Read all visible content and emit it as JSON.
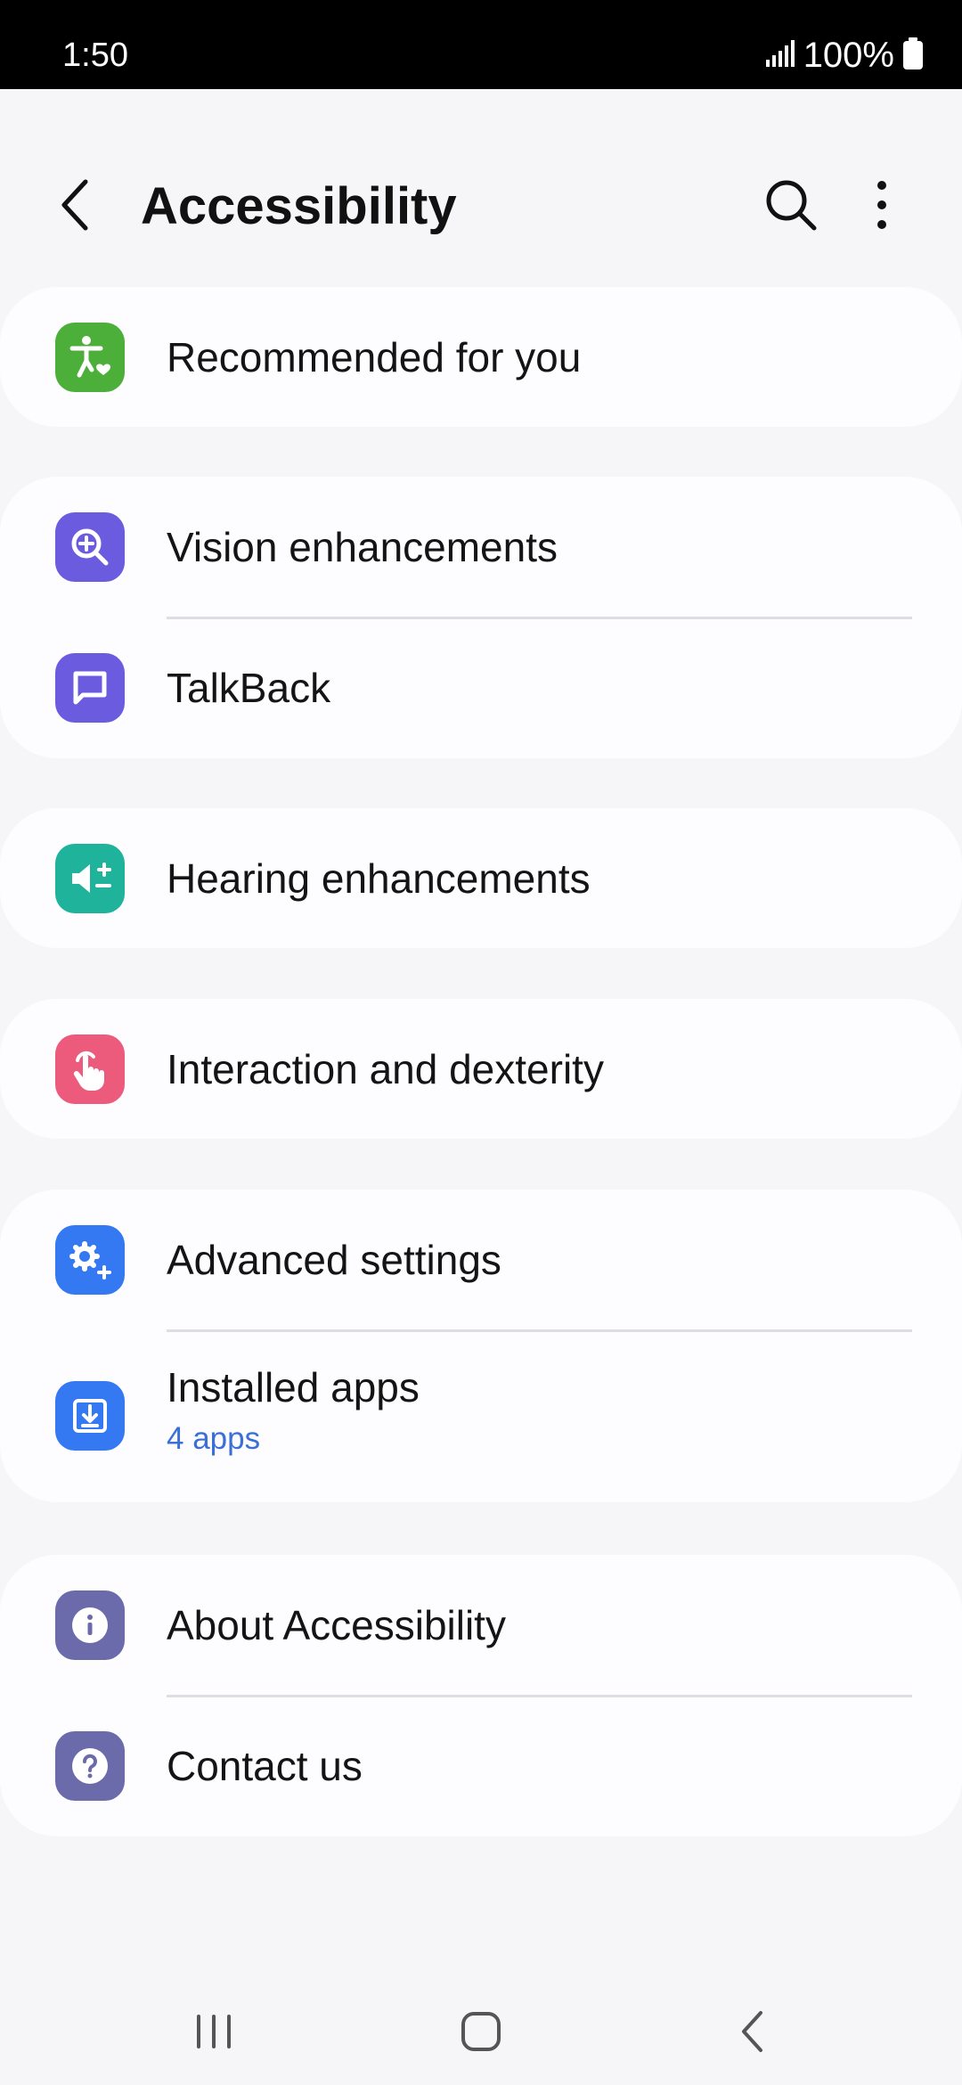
{
  "status_bar": {
    "time": "1:50",
    "battery": "100%"
  },
  "header": {
    "title": "Accessibility"
  },
  "groups": [
    {
      "items": [
        {
          "label": "Recommended for you",
          "icon": "accessibility-person-icon",
          "color": "#4caf3a"
        }
      ]
    },
    {
      "items": [
        {
          "label": "Vision enhancements",
          "icon": "magnifier-plus-icon",
          "color": "#6a5bdf"
        },
        {
          "label": "TalkBack",
          "icon": "speech-bubble-icon",
          "color": "#6a5bdf"
        }
      ]
    },
    {
      "items": [
        {
          "label": "Hearing enhancements",
          "icon": "speaker-plus-minus-icon",
          "color": "#1fb39b"
        }
      ]
    },
    {
      "items": [
        {
          "label": "Interaction and dexterity",
          "icon": "touch-hand-icon",
          "color": "#ec5b7c"
        }
      ]
    },
    {
      "items": [
        {
          "label": "Advanced settings",
          "icon": "gear-plus-icon",
          "color": "#3478f2"
        },
        {
          "label": "Installed apps",
          "sublabel": "4 apps",
          "icon": "download-box-icon",
          "color": "#3478f2"
        }
      ]
    },
    {
      "items": [
        {
          "label": "About Accessibility",
          "icon": "info-icon",
          "color": "#6b6bab"
        },
        {
          "label": "Contact us",
          "icon": "question-icon",
          "color": "#6b6bab"
        }
      ]
    }
  ]
}
